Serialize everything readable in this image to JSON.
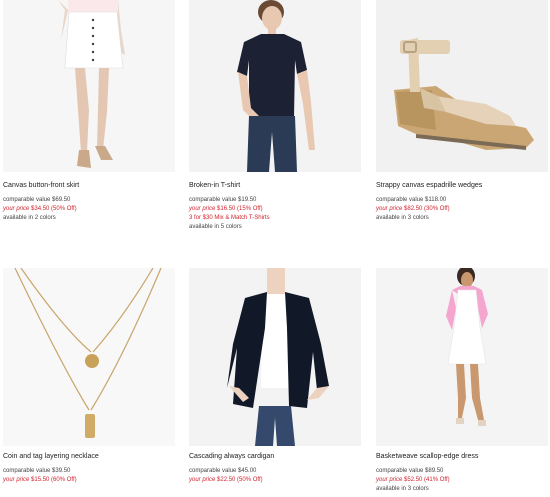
{
  "products": [
    {
      "name": "Canvas button-front skirt",
      "comparable": "comparable value $69.50",
      "price_label": "your price",
      "price": "$34.50",
      "discount": "(50% Off)",
      "promo": "",
      "colors": "available in 2 colors"
    },
    {
      "name": "Broken-in T-shirt",
      "comparable": "comparable value $19.50",
      "price_label": "your price",
      "price": "$16.50",
      "discount": "(15% Off)",
      "promo": "3 for $30 Mix & Match T-Shirts",
      "colors": "available in 5 colors"
    },
    {
      "name": "Strappy canvas espadrille wedges",
      "comparable": "comparable value $118.00",
      "price_label": "your price",
      "price": "$82.50",
      "discount": "(30% Off)",
      "promo": "",
      "colors": "available in 3 colors"
    },
    {
      "name": "Coin and tag layering necklace",
      "comparable": "comparable value $39.50",
      "price_label": "your price",
      "price": "$15.50",
      "discount": "(60% Off)",
      "promo": "",
      "colors": ""
    },
    {
      "name": "Cascading always cardigan",
      "comparable": "comparable value $45.00",
      "price_label": "your price",
      "price": "$22.50",
      "discount": "(50% Off)",
      "promo": "",
      "colors": ""
    },
    {
      "name": "Basketweave scallop-edge dress",
      "comparable": "comparable value $89.50",
      "price_label": "your price",
      "price": "$52.50",
      "discount": "(41% Off)",
      "promo": "",
      "colors": "available in 3 colors"
    }
  ],
  "colors": {
    "sale_red": "#d0232e",
    "image_bg": "#f4f4f4"
  }
}
